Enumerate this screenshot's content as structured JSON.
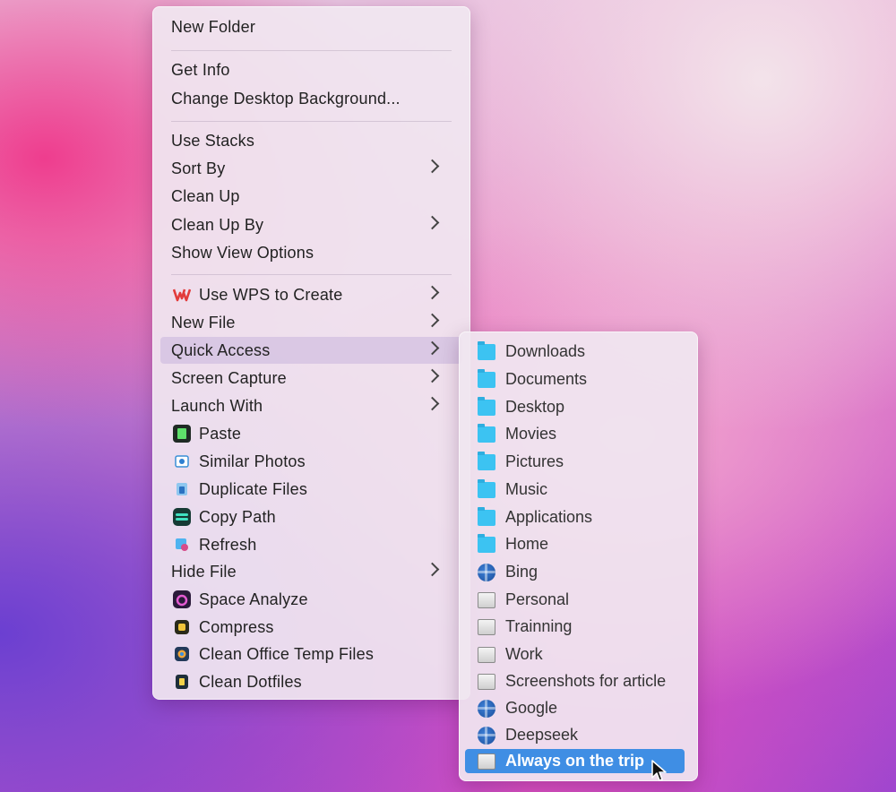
{
  "main_menu": {
    "items": [
      {
        "label": "New Folder"
      },
      {
        "label": "Get Info"
      },
      {
        "label": "Change Desktop Background..."
      },
      {
        "label": "Use Stacks"
      },
      {
        "label": "Sort By"
      },
      {
        "label": "Clean Up"
      },
      {
        "label": "Clean Up By"
      },
      {
        "label": "Show View Options"
      },
      {
        "label": "Use WPS to Create",
        "icon": "wps-icon"
      },
      {
        "label": "New File"
      },
      {
        "label": "Quick Access"
      },
      {
        "label": "Screen Capture"
      },
      {
        "label": "Launch With"
      },
      {
        "label": "Paste",
        "icon": "paste-icon"
      },
      {
        "label": "Similar Photos",
        "icon": "similar-photos-icon"
      },
      {
        "label": "Duplicate Files",
        "icon": "duplicate-files-icon"
      },
      {
        "label": "Copy Path",
        "icon": "copy-path-icon"
      },
      {
        "label": "Refresh",
        "icon": "refresh-icon"
      },
      {
        "label": "Hide File"
      },
      {
        "label": "Space Analyze",
        "icon": "space-analyze-icon"
      },
      {
        "label": "Compress",
        "icon": "compress-icon"
      },
      {
        "label": "Clean Office Temp Files",
        "icon": "clean-office-icon"
      },
      {
        "label": "Clean Dotfiles",
        "icon": "clean-dotfiles-icon"
      }
    ]
  },
  "quick_access": {
    "items": [
      {
        "label": "Downloads",
        "icon": "folder-icon"
      },
      {
        "label": "Documents",
        "icon": "folder-icon"
      },
      {
        "label": "Desktop",
        "icon": "folder-icon"
      },
      {
        "label": "Movies",
        "icon": "folder-icon"
      },
      {
        "label": "Pictures",
        "icon": "folder-icon"
      },
      {
        "label": "Music",
        "icon": "folder-icon"
      },
      {
        "label": "Applications",
        "icon": "folder-icon"
      },
      {
        "label": "Home",
        "icon": "folder-icon"
      },
      {
        "label": "Bing",
        "icon": "globe-icon"
      },
      {
        "label": "Personal",
        "icon": "drive-icon"
      },
      {
        "label": "Trainning",
        "icon": "drive-icon"
      },
      {
        "label": "Work",
        "icon": "drive-icon"
      },
      {
        "label": "Screenshots for article",
        "icon": "drive-icon"
      },
      {
        "label": "Google",
        "icon": "globe-icon"
      },
      {
        "label": "Deepseek",
        "icon": "globe-icon"
      },
      {
        "label": "Always on the trip",
        "icon": "drive-icon",
        "selected": true
      }
    ]
  },
  "colors": {
    "selection": "#3f8ee4",
    "folder": "#3cc3f2",
    "wps": "#e23b3b"
  }
}
